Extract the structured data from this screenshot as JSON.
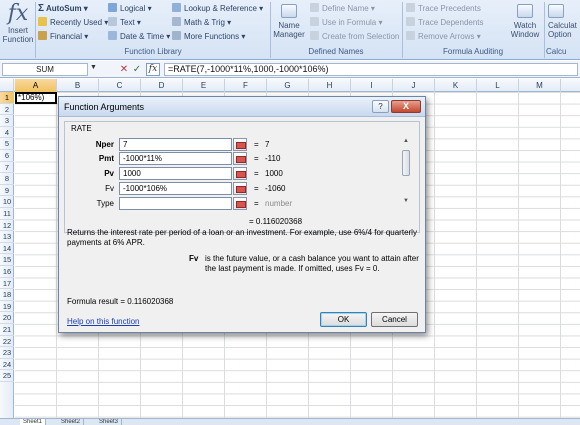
{
  "ribbon": {
    "insert_function": {
      "line1": "Insert",
      "line2": "Function"
    },
    "library": {
      "autosum": "AutoSum",
      "recently_used": "Recently Used",
      "financial": "Financial",
      "logical": "Logical",
      "text": "Text",
      "date_time": "Date & Time",
      "lookup": "Lookup & Reference",
      "math": "Math & Trig",
      "more": "More Functions",
      "group_label": "Function Library"
    },
    "defined_names": {
      "name_manager_line1": "Name",
      "name_manager_line2": "Manager",
      "define_name": "Define Name",
      "use_in_formula": "Use in Formula",
      "create_from_selection": "Create from Selection",
      "group_label": "Defined Names"
    },
    "auditing": {
      "trace_precedents": "Trace Precedents",
      "trace_dependents": "Trace Dependents",
      "remove_arrows": "Remove Arrows",
      "watch_line1": "Watch",
      "watch_line2": "Window",
      "group_label": "Formula Auditing"
    },
    "calculation": {
      "calc_line1": "Calculat",
      "calc_line2": "Option",
      "group_label": "Calcu"
    }
  },
  "formula_bar": {
    "name_box": "SUM",
    "cancel_glyph": "✕",
    "enter_glyph": "✓",
    "fx_label": "fx",
    "formula": "=RATE(7,-1000*11%,1000,-1000*106%)"
  },
  "columns": [
    "A",
    "B",
    "C",
    "D",
    "E",
    "F",
    "G",
    "H",
    "I",
    "J",
    "K",
    "L",
    "M"
  ],
  "rows": [
    "1",
    "2",
    "3",
    "4",
    "5",
    "6",
    "7",
    "8",
    "9",
    "10",
    "11",
    "12",
    "13",
    "14",
    "15",
    "16",
    "17",
    "18",
    "19",
    "20",
    "21",
    "22",
    "23",
    "24",
    "25"
  ],
  "cell_a1": "*106%)",
  "dialog": {
    "title": "Function Arguments",
    "help_glyph": "?",
    "close_glyph": "X",
    "function_name": "RATE",
    "args": [
      {
        "label": "Nper",
        "value": "7",
        "result": "7"
      },
      {
        "label": "Pmt",
        "value": "-1000*11%",
        "result": "-110"
      },
      {
        "label": "Pv",
        "value": "1000",
        "result": "1000"
      },
      {
        "label": "Fv",
        "value": "-1000*106%",
        "result": "-1060"
      },
      {
        "label": "Type",
        "value": "",
        "result": "number"
      }
    ],
    "equals": "=",
    "overall_result": "= 0.116020368",
    "description": "Returns the interest rate per period of a loan or an investment. For example, use 6%/4 for quarterly payments at 6% APR.",
    "arg_help_name": "Fv",
    "arg_help_text": "is the future value, or a cash balance you want to attain after the last payment is made. If omitted, uses Fv = 0.",
    "formula_result": "Formula result =  0.116020368",
    "help_link": "Help on this function",
    "ok": "OK",
    "cancel": "Cancel"
  },
  "sheet_tabs": [
    "Sheet1",
    "Sheet2",
    "Sheet3"
  ]
}
